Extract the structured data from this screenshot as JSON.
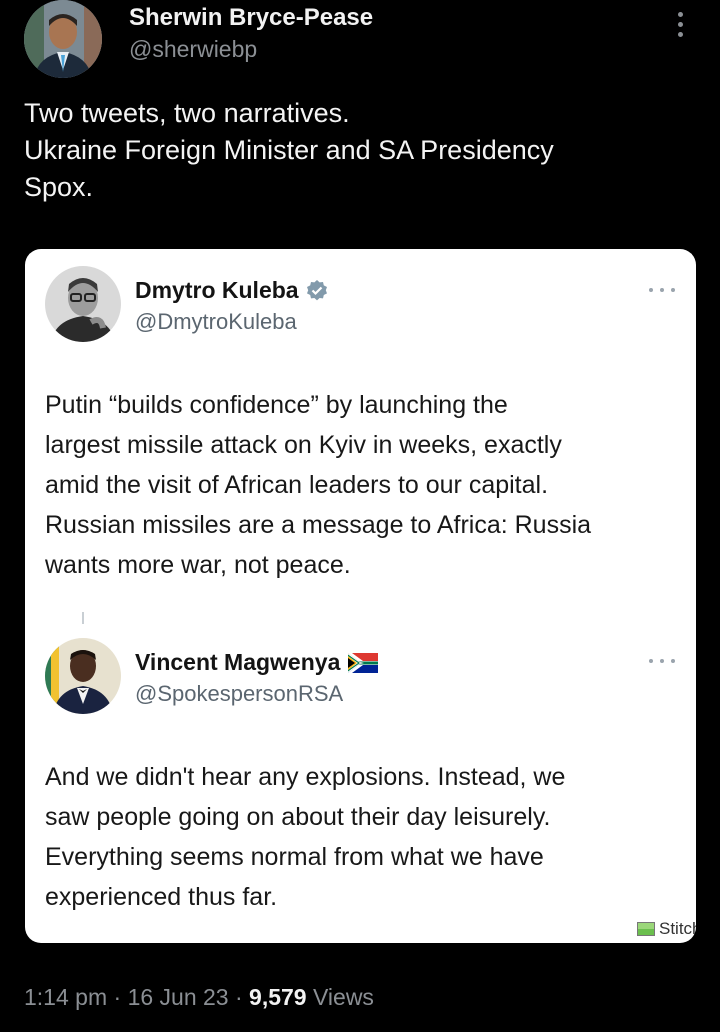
{
  "post": {
    "author_name": "Sherwin Bryce-Pease",
    "author_handle": "@sherwiebp",
    "text_lines": [
      "Two tweets, two narratives.",
      "Ukraine Foreign Minister and SA Presidency",
      "Spox."
    ],
    "time": "1:14 pm",
    "date": "16 Jun 23",
    "separator": "·",
    "views_count": "9,579",
    "views_label": "Views"
  },
  "embedded_tweets": [
    {
      "name": "Dmytro Kuleba",
      "handle": "@DmytroKuleba",
      "badge_icon": "verified-badge-icon",
      "body_lines": [
        "Putin “builds confidence” by launching the",
        "largest missile attack on Kyiv in weeks, exactly",
        "amid the visit of African leaders to our capital.",
        "Russian missiles are a message to Africa: Russia",
        "wants more war, not peace."
      ]
    },
    {
      "name": "Vincent Magwenya",
      "handle": "@SpokespersonRSA",
      "badge_icon": "south-africa-flag-icon",
      "body_lines": [
        "And we didn't hear any explosions. Instead, we",
        "saw people going on about their day leisurely.",
        "Everything seems normal from what we have",
        "experienced thus far."
      ]
    }
  ],
  "watermark": "Stitch It!",
  "colors": {
    "background": "#000000",
    "card_background": "#ffffff",
    "secondary_text": "#8b8f94",
    "verified_blue": "#829aab"
  }
}
